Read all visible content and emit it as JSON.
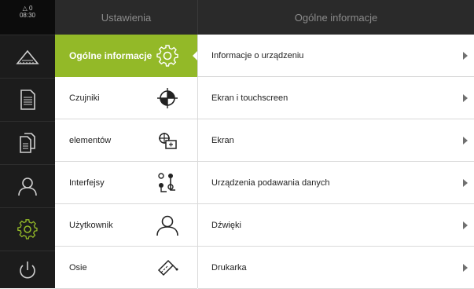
{
  "status": {
    "warnings": "△ 0",
    "time": "08:30"
  },
  "rail": {
    "items": [
      {
        "icon": "measure-triangle-icon",
        "active": false
      },
      {
        "icon": "document-icon",
        "active": false
      },
      {
        "icon": "documents-icon",
        "active": false
      },
      {
        "icon": "user-icon",
        "active": false
      },
      {
        "icon": "gear-icon",
        "active": true
      },
      {
        "icon": "power-icon",
        "active": false
      }
    ]
  },
  "menu": {
    "title": "Ustawienia",
    "items": [
      {
        "label": "Ogólne informacje",
        "icon": "gear-icon",
        "active": true
      },
      {
        "label": "Czujniki",
        "icon": "crosshair-target-icon",
        "active": false
      },
      {
        "label": "elementów",
        "icon": "feature-elements-icon",
        "active": false
      },
      {
        "label": "Interfejsy",
        "icon": "interfaces-icon",
        "active": false
      },
      {
        "label": "Użytkownik",
        "icon": "user-icon",
        "active": false
      },
      {
        "label": "Osie",
        "icon": "axes-ruler-icon",
        "active": false
      }
    ]
  },
  "main": {
    "title": "Ogólne informacje",
    "rows": [
      {
        "label": "Informacje o urządzeniu"
      },
      {
        "label": "Ekran i touchscreen"
      },
      {
        "label": "Ekran"
      },
      {
        "label": "Urządzenia podawania danych"
      },
      {
        "label": "Dźwięki"
      },
      {
        "label": "Drukarka"
      }
    ]
  },
  "colors": {
    "accent": "#93b928",
    "rail_bg": "#1c1c1c",
    "header_bg": "#2a2a2a"
  }
}
